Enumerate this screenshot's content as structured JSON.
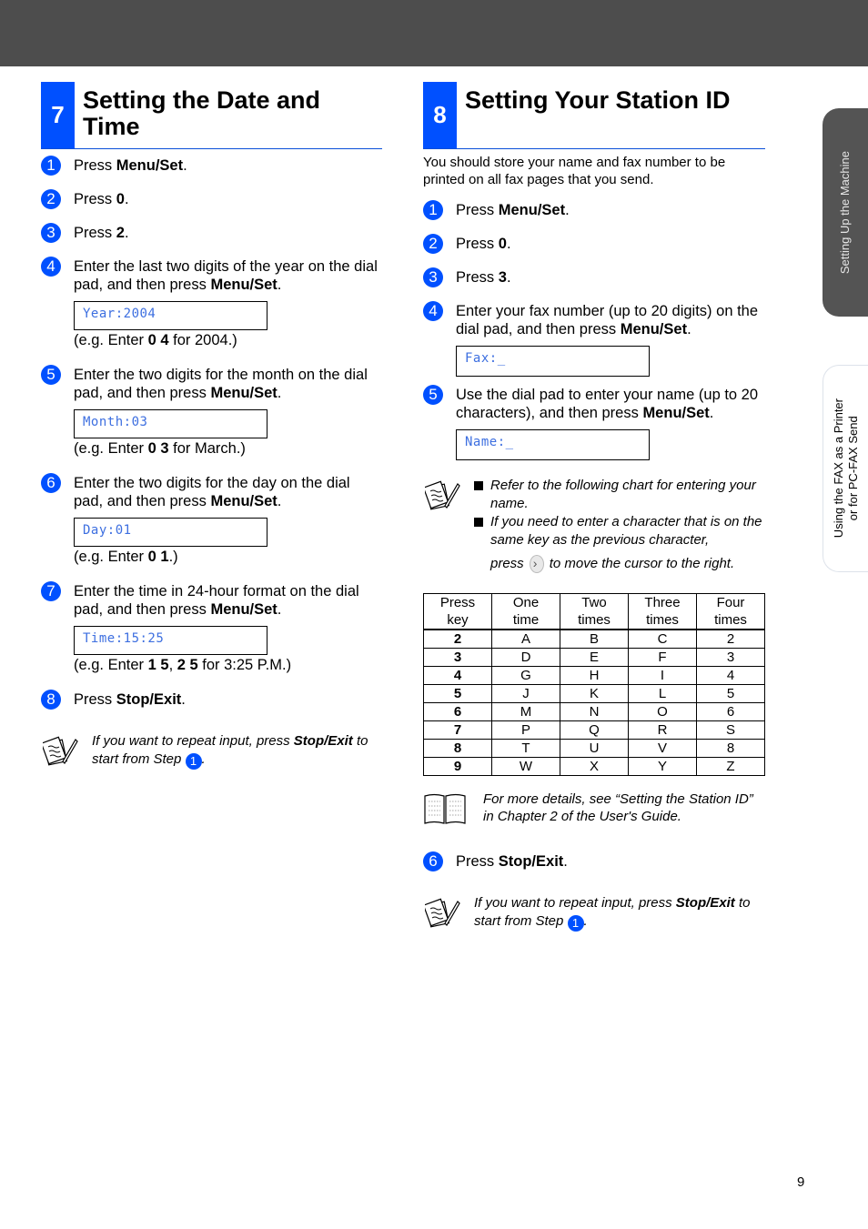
{
  "header": {
    "bar_color": "#4d4d4d",
    "accent_color": "#0050ff"
  },
  "left_section": {
    "number": "7",
    "title": "Setting the Date and Time",
    "steps": [
      {
        "num": "1",
        "text": "Press ",
        "bold": "Menu/Set",
        "after": "."
      },
      {
        "num": "2",
        "text": "Press ",
        "bold": "0",
        "after": "."
      },
      {
        "num": "3",
        "text": "Press ",
        "bold": "2",
        "after": "."
      },
      {
        "num": "4",
        "text": "Enter the last two digits of the year on the dial pad, and then press ",
        "bold": "Menu/Set",
        "after": ".",
        "lcd": "Year:2004",
        "example_pre": "(e.g. Enter ",
        "example_bold": "0 4",
        "example_post": " for 2004.)"
      },
      {
        "num": "5",
        "text": "Enter the two digits for the month on the dial pad, and then press ",
        "bold": "Menu/Set",
        "after": ".",
        "lcd": "Month:03",
        "example_pre": "(e.g. Enter ",
        "example_bold": "0 3",
        "example_post": " for March.)"
      },
      {
        "num": "6",
        "text": "Enter the two digits for the day on the dial pad, and then press ",
        "bold": "Menu/Set",
        "after": ".",
        "lcd": "Day:01",
        "example_pre": "(e.g. Enter ",
        "example_bold": "0 1",
        "example_post": ".)"
      },
      {
        "num": "7",
        "text": "Enter the time in 24-hour format on the dial pad, and then press ",
        "bold": "Menu/Set",
        "after": ".",
        "lcd": "Time:15:25",
        "example_pre": "(e.g. Enter ",
        "example_bold": "1 5",
        "example_mid": ", ",
        "example_bold2": "2 5",
        "example_post": " for 3:25 P.M.)"
      },
      {
        "num": "8",
        "text": "Press ",
        "bold": "Stop/Exit",
        "after": "."
      }
    ],
    "note": {
      "pre": "If you want to repeat input, press ",
      "bold": "Stop/Exit",
      "post": " to start from Step ",
      "step_ref": "1",
      "end": "."
    }
  },
  "right_section": {
    "number": "8",
    "title": "Setting Your Station ID",
    "intro": "You should store your name and fax number to be printed on all fax pages that you send.",
    "steps": [
      {
        "num": "1",
        "text": "Press ",
        "bold": "Menu/Set",
        "after": "."
      },
      {
        "num": "2",
        "text": "Press ",
        "bold": "0",
        "after": "."
      },
      {
        "num": "3",
        "text": "Press ",
        "bold": "3",
        "after": "."
      },
      {
        "num": "4",
        "text": "Enter your fax number (up to 20 digits) on the dial pad, and then press ",
        "bold": "Menu/Set",
        "after": ".",
        "lcd": "Fax:_"
      },
      {
        "num": "5",
        "text": "Use the dial pad to enter your name (up to 20 characters), and then press ",
        "bold": "Menu/Set",
        "after": ".",
        "lcd": "Name:_"
      },
      {
        "num": "6",
        "text": "Press ",
        "bold": "Stop/Exit",
        "after": "."
      }
    ],
    "tip_bullets": [
      "Refer to the following chart for entering your name.",
      "If you need to enter a character that is on the same key as the previous character,"
    ],
    "tip_press": "press",
    "tip_press_after": "to move the cursor to the right.",
    "char_table": {
      "headers": [
        [
          "Press",
          "key"
        ],
        [
          "One",
          "time"
        ],
        [
          "Two",
          "times"
        ],
        [
          "Three",
          "times"
        ],
        [
          "Four",
          "times"
        ]
      ],
      "rows": [
        [
          "2",
          "A",
          "B",
          "C",
          "2"
        ],
        [
          "3",
          "D",
          "E",
          "F",
          "3"
        ],
        [
          "4",
          "G",
          "H",
          "I",
          "4"
        ],
        [
          "5",
          "J",
          "K",
          "L",
          "5"
        ],
        [
          "6",
          "M",
          "N",
          "O",
          "6"
        ],
        [
          "7",
          "P",
          "Q",
          "R",
          "S"
        ],
        [
          "8",
          "T",
          "U",
          "V",
          "8"
        ],
        [
          "9",
          "W",
          "X",
          "Y",
          "Z"
        ]
      ]
    },
    "reference": "For more details, see “Setting the Station ID” in Chapter 2 of the User's Guide.",
    "note": {
      "pre": "If you want to repeat input, press ",
      "bold": "Stop/Exit",
      "post": " to start from Step ",
      "step_ref": "1",
      "end": "."
    }
  },
  "side_tabs": [
    {
      "label": "Setting Up the Machine",
      "active": true
    },
    {
      "label_line1": "Using the FAX as a Printer",
      "label_line2": "or for PC-FAX Send",
      "active": false
    }
  ],
  "page_number": "9"
}
